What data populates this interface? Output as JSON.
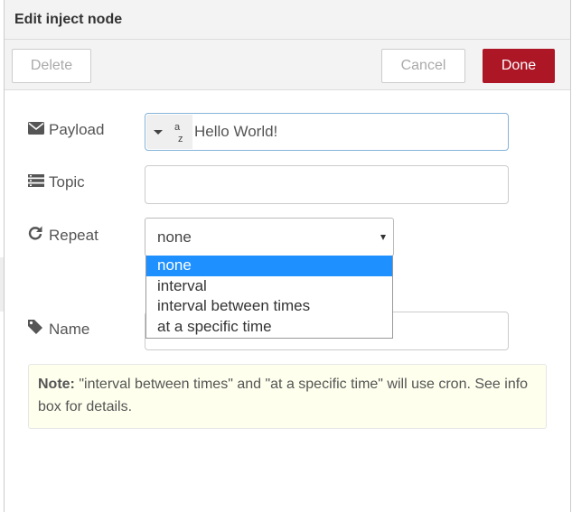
{
  "dialog": {
    "title": "Edit inject node"
  },
  "toolbar": {
    "delete_label": "Delete",
    "cancel_label": "Cancel",
    "done_label": "Done"
  },
  "form": {
    "payload": {
      "label": "Payload",
      "icon": "envelope-icon",
      "type_icon": "string-az-icon",
      "value": "Hello World!"
    },
    "topic": {
      "label": "Topic",
      "icon": "tasks-icon",
      "value": ""
    },
    "repeat": {
      "label": "Repeat",
      "icon": "repeat-icon",
      "selected": "none",
      "options": [
        "none",
        "interval",
        "interval between times",
        "at a specific time"
      ]
    },
    "name": {
      "label": "Name",
      "icon": "tag-icon",
      "value": ""
    }
  },
  "note": {
    "bold": "Note:",
    "text": " \"interval between times\" and \"at a specific time\" will use cron. See info box for details."
  },
  "colors": {
    "done_button": "#ad1625",
    "selected_option": "#1e90ff",
    "note_background": "#ffffee"
  }
}
